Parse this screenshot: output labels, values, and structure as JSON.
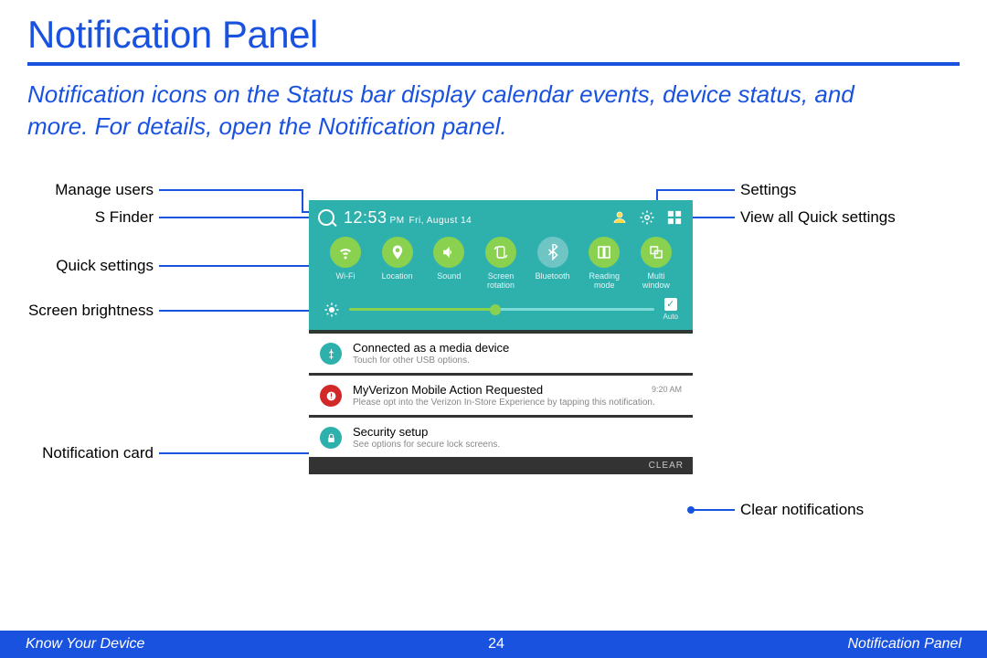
{
  "title": "Notification Panel",
  "intro": "Notification icons on the Status bar display calendar events, device status, and more. For details, open the Notification panel.",
  "labels": {
    "manage_users": "Manage users",
    "s_finder": "S Finder",
    "quick_settings": "Quick settings",
    "screen_brightness": "Screen brightness",
    "notification_card": "Notification card",
    "settings": "Settings",
    "view_all": "View all Quick settings",
    "clear_notifications": "Clear notifications"
  },
  "panel": {
    "time": "12:53",
    "ampm": "PM",
    "date": "Fri, August 14",
    "qs": [
      {
        "id": "wifi",
        "label": "Wi-Fi",
        "on": true
      },
      {
        "id": "location",
        "label": "Location",
        "on": true
      },
      {
        "id": "sound",
        "label": "Sound",
        "on": true
      },
      {
        "id": "rotation",
        "label": "Screen\nrotation",
        "on": true
      },
      {
        "id": "bluetooth",
        "label": "Bluetooth",
        "on": false
      },
      {
        "id": "reading",
        "label": "Reading\nmode",
        "on": true
      },
      {
        "id": "multi",
        "label": "Multi\nwindow",
        "on": true
      }
    ],
    "auto_label": "Auto",
    "cards": [
      {
        "icon": "usb",
        "color": "#2eb0ad",
        "title": "Connected as a media device",
        "sub": "Touch for other USB options.",
        "time": ""
      },
      {
        "icon": "warn",
        "color": "#d22828",
        "title": "MyVerizon Mobile Action Requested",
        "sub": "Please opt into the Verizon In-Store Experience by tapping this notification.",
        "time": "9:20 AM"
      },
      {
        "icon": "lock",
        "color": "#2eb0ad",
        "title": "Security setup",
        "sub": "See options for secure lock screens.",
        "time": ""
      }
    ],
    "clear": "CLEAR"
  },
  "footer": {
    "left": "Know Your Device",
    "center": "24",
    "right": "Notification Panel"
  }
}
